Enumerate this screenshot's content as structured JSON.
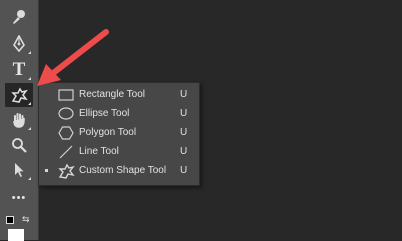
{
  "toolbar": {
    "tools": [
      {
        "icon": "brush-icon"
      },
      {
        "icon": "pen-icon"
      },
      {
        "icon": "type-icon",
        "glyph": "T"
      },
      {
        "icon": "custom-shape-icon",
        "active": true
      },
      {
        "icon": "hand-icon"
      },
      {
        "icon": "zoom-icon"
      },
      {
        "icon": "select-arrow-icon"
      },
      {
        "icon": "more-tools-icon",
        "glyph": "•••"
      },
      {
        "icon": "color-swatch-icon"
      }
    ]
  },
  "flyout": {
    "items": [
      {
        "label": "Rectangle Tool",
        "shortcut": "U",
        "icon": "rectangle-icon",
        "selected": false
      },
      {
        "label": "Ellipse Tool",
        "shortcut": "U",
        "icon": "ellipse-icon",
        "selected": false
      },
      {
        "label": "Polygon Tool",
        "shortcut": "U",
        "icon": "polygon-icon",
        "selected": false
      },
      {
        "label": "Line Tool",
        "shortcut": "U",
        "icon": "line-icon",
        "selected": false
      },
      {
        "label": "Custom Shape Tool",
        "shortcut": "U",
        "icon": "custom-shape-icon",
        "selected": true
      }
    ]
  },
  "annotation": {
    "arrow_color": "#ee4b4b"
  },
  "colors": {
    "canvas": "#282828",
    "toolbar": "#535353",
    "menu": "#474747",
    "text": "#e2e2e2"
  }
}
